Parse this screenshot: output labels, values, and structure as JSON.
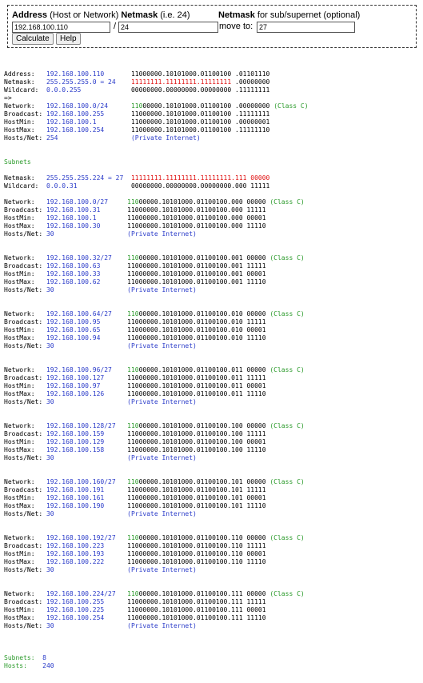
{
  "form": {
    "address_label": "Address",
    "address_hint": "(Host or Network)",
    "netmask_label": "Netmask",
    "netmask_hint": "(i.e. 24)",
    "subnet_label": "Netmask",
    "subnet_hint": "for sub/supernet (optional)",
    "address_value": "192.168.100.110",
    "slash": "/",
    "netmask_value": "24",
    "move_to_label": "move to:",
    "subnet_value": "27",
    "calculate_button": "Calculate",
    "help_button": "Help"
  },
  "colors": {
    "value": "#2a3bc9",
    "mask_bits": "#e01010",
    "network_bits": "#2a9a2a"
  },
  "result": {
    "address": {
      "label": "Address:",
      "value": "192.168.100.110",
      "bin": "11000000.10101000.01100100 .01101110"
    },
    "netmask": {
      "label": "Netmask:",
      "value": "255.255.255.0 = 24",
      "bin_red": "11111111.11111111.11111111",
      "bin_tail": " .00000000"
    },
    "wildcard": {
      "label": "Wildcard:",
      "value": "0.0.0.255",
      "bin": "00000000.00000000.00000000 .11111111"
    },
    "arrow": "=>",
    "network": {
      "label": "Network:",
      "value": "192.168.100.0/24",
      "bin_green": "110",
      "bin_rest": "00000.10101000.01100100 .00000000",
      "class": "(Class C)"
    },
    "broadcast": {
      "label": "Broadcast:",
      "value": "192.168.100.255",
      "bin": "11000000.10101000.01100100 .11111111"
    },
    "hostmin": {
      "label": "HostMin:",
      "value": "192.168.100.1",
      "bin": "11000000.10101000.01100100 .00000001"
    },
    "hostmax": {
      "label": "HostMax:",
      "value": "192.168.100.254",
      "bin": "11000000.10101000.01100100 .11111110"
    },
    "hosts": {
      "label": "Hosts/Net:",
      "value": "254",
      "note": "(Private Internet)"
    }
  },
  "subnets_heading": "Subnets",
  "subnet_mask": {
    "netmask": {
      "label": "Netmask:",
      "value": "255.255.255.224 = 27",
      "bin_red": "11111111.11111111.11111111.111",
      "bin_tail": " 00000"
    },
    "wildcard": {
      "label": "Wildcard:",
      "value": "0.0.0.31",
      "bin": "00000000.00000000.00000000.000 11111"
    }
  },
  "labels": {
    "network": "Network:",
    "broadcast": "Broadcast:",
    "hostmin": "HostMin:",
    "hostmax": "HostMax:",
    "hosts": "Hosts/Net:",
    "class": "(Class C)",
    "private": "(Private Internet)"
  },
  "bin_prefix": "11000000.10101000.01100100",
  "subnets": [
    {
      "network": "192.168.100.0/27",
      "broadcast": "192.168.100.31",
      "hostmin": "192.168.100.1",
      "hostmax": "192.168.100.30",
      "hosts": "30",
      "bits": "000"
    },
    {
      "network": "192.168.100.32/27",
      "broadcast": "192.168.100.63",
      "hostmin": "192.168.100.33",
      "hostmax": "192.168.100.62",
      "hosts": "30",
      "bits": "001"
    },
    {
      "network": "192.168.100.64/27",
      "broadcast": "192.168.100.95",
      "hostmin": "192.168.100.65",
      "hostmax": "192.168.100.94",
      "hosts": "30",
      "bits": "010"
    },
    {
      "network": "192.168.100.96/27",
      "broadcast": "192.168.100.127",
      "hostmin": "192.168.100.97",
      "hostmax": "192.168.100.126",
      "hosts": "30",
      "bits": "011"
    },
    {
      "network": "192.168.100.128/27",
      "broadcast": "192.168.100.159",
      "hostmin": "192.168.100.129",
      "hostmax": "192.168.100.158",
      "hosts": "30",
      "bits": "100"
    },
    {
      "network": "192.168.100.160/27",
      "broadcast": "192.168.100.191",
      "hostmin": "192.168.100.161",
      "hostmax": "192.168.100.190",
      "hosts": "30",
      "bits": "101"
    },
    {
      "network": "192.168.100.192/27",
      "broadcast": "192.168.100.223",
      "hostmin": "192.168.100.193",
      "hostmax": "192.168.100.222",
      "hosts": "30",
      "bits": "110"
    },
    {
      "network": "192.168.100.224/27",
      "broadcast": "192.168.100.255",
      "hostmin": "192.168.100.225",
      "hostmax": "192.168.100.254",
      "hosts": "30",
      "bits": "111"
    }
  ],
  "summary": {
    "subnets_label": "Subnets:",
    "subnets_value": "8",
    "hosts_label": "Hosts:",
    "hosts_value": "240"
  }
}
